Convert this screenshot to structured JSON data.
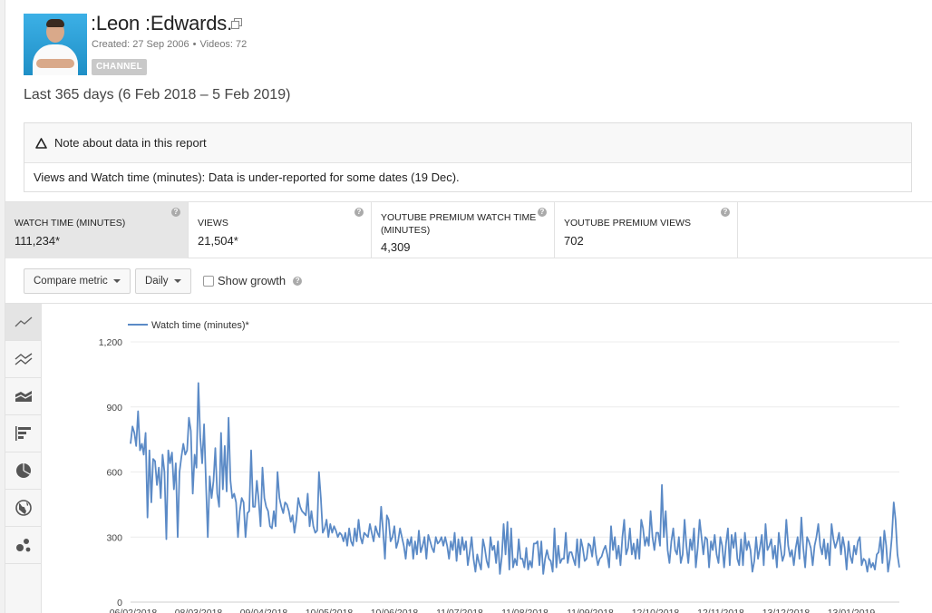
{
  "channel": {
    "name": ":Leon :Edwards.",
    "created": "Created: 27 Sep 2006",
    "separator": "•",
    "videos": "Videos: 72",
    "badge": "CHANNEL"
  },
  "date_range": "Last 365 days (6 Feb 2018 – 5 Feb 2019)",
  "note": {
    "title": "Note about data in this report",
    "body": "Views and Watch time (minutes): Data is under-reported for some dates (19 Dec)."
  },
  "metrics": [
    {
      "label": "WATCH TIME (MINUTES)",
      "value": "111,234*",
      "active": true
    },
    {
      "label": "VIEWS",
      "value": "21,504*",
      "active": false
    },
    {
      "label": "YOUTUBE PREMIUM WATCH TIME (MINUTES)",
      "value": "4,309",
      "active": false
    },
    {
      "label": "YOUTUBE PREMIUM VIEWS",
      "value": "702",
      "active": false
    }
  ],
  "controls": {
    "compare_metric": "Compare metric",
    "granularity": "Daily",
    "show_growth": "Show growth",
    "show_growth_checked": false
  },
  "chart_types": [
    "line-chart-icon",
    "multi-line-chart-icon",
    "stacked-area-chart-icon",
    "bar-chart-icon",
    "pie-chart-icon",
    "globe-map-icon",
    "bubble-chart-icon"
  ],
  "chart_data": {
    "type": "line",
    "legend": [
      "Watch time (minutes)*"
    ],
    "ylim": [
      0,
      1200
    ],
    "yticks": [
      "1,200",
      "900",
      "600",
      "300",
      "0"
    ],
    "xticks": [
      "06/02/2018",
      "08/03/2018",
      "09/04/2018",
      "10/05/2018",
      "10/06/2018",
      "11/07/2018",
      "11/08/2018",
      "11/09/2018",
      "12/10/2018",
      "12/11/2018",
      "13/12/2018",
      "13/01/2019"
    ],
    "grid": true,
    "color": "#5b8ac6",
    "series": [
      {
        "name": "Watch time (minutes)*",
        "values": [
          730,
          810,
          780,
          720,
          880,
          700,
          730,
          680,
          780,
          390,
          700,
          460,
          660,
          650,
          540,
          620,
          480,
          680,
          600,
          290,
          700,
          640,
          690,
          520,
          640,
          300,
          600,
          670,
          730,
          680,
          700,
          850,
          790,
          500,
          680,
          620,
          1010,
          760,
          640,
          820,
          560,
          300,
          580,
          480,
          560,
          710,
          500,
          440,
          780,
          520,
          720,
          510,
          850,
          560,
          480,
          500,
          460,
          300,
          420,
          480,
          460,
          300,
          410,
          420,
          700,
          440,
          440,
          560,
          470,
          350,
          620,
          480,
          440,
          420,
          350,
          340,
          420,
          350,
          600,
          480,
          440,
          410,
          460,
          450,
          420,
          370,
          400,
          320,
          380,
          480,
          440,
          420,
          410,
          400,
          500,
          350,
          420,
          350,
          320,
          330,
          600,
          480,
          320,
          340,
          380,
          300,
          360,
          320,
          350,
          330,
          300,
          320,
          310,
          280,
          320,
          260,
          340,
          280,
          260,
          340,
          280,
          380,
          300,
          270,
          320,
          310,
          300,
          360,
          320,
          280,
          350,
          320,
          300,
          440,
          330,
          200,
          400,
          380,
          280,
          300,
          350,
          250,
          280,
          340,
          300,
          260,
          200,
          290,
          260,
          300,
          200,
          280,
          220,
          330,
          230,
          260,
          300,
          200,
          310,
          280,
          250,
          230,
          300,
          270,
          280,
          300,
          260,
          300,
          260,
          200,
          280,
          240,
          320,
          190,
          290,
          220,
          300,
          240,
          280,
          170,
          230,
          300,
          200,
          140,
          220,
          180,
          150,
          290,
          250,
          190,
          160,
          300,
          240,
          260,
          180,
          280,
          130,
          210,
          360,
          220,
          370,
          150,
          340,
          160,
          200,
          170,
          290,
          200,
          200,
          160,
          250,
          150,
          190,
          160,
          270,
          270,
          280,
          170,
          280,
          130,
          200,
          240,
          200,
          190,
          140,
          340,
          160,
          260,
          180,
          200,
          200,
          320,
          180,
          230,
          230,
          200,
          170,
          290,
          160,
          290,
          250,
          190,
          200,
          270,
          260,
          210,
          300,
          220,
          170,
          200,
          210,
          240,
          260,
          220,
          160,
          350,
          240,
          300,
          200,
          260,
          170,
          300,
          380,
          220,
          250,
          340,
          220,
          270,
          200,
          290,
          200,
          380,
          340,
          260,
          300,
          260,
          420,
          300,
          240,
          320,
          320,
          260,
          540,
          300,
          420,
          240,
          180,
          280,
          340,
          240,
          220,
          300,
          180,
          220,
          380,
          260,
          180,
          290,
          240,
          340,
          160,
          250,
          380,
          300,
          220,
          300,
          290,
          160,
          280,
          240,
          310,
          220,
          180,
          300,
          260,
          160,
          270,
          340,
          170,
          310,
          250,
          320,
          200,
          170,
          290,
          170,
          320,
          240,
          280,
          240,
          140,
          190,
          300,
          200,
          250,
          310,
          170,
          360,
          240,
          260,
          290,
          200,
          260,
          160,
          320,
          250,
          190,
          220,
          380,
          260,
          210,
          240,
          170,
          250,
          300,
          200,
          390,
          250,
          160,
          300,
          280,
          250,
          170,
          260,
          300,
          360,
          260,
          220,
          290,
          200,
          270,
          170,
          360,
          290,
          250,
          280,
          320,
          220,
          300,
          250,
          150,
          280,
          210,
          180,
          260,
          220,
          280,
          300,
          170,
          200,
          190,
          140,
          200,
          160,
          180,
          150,
          220,
          230,
          300,
          180,
          330,
          260,
          140,
          200,
          300,
          460,
          380,
          220,
          160
        ]
      }
    ]
  }
}
